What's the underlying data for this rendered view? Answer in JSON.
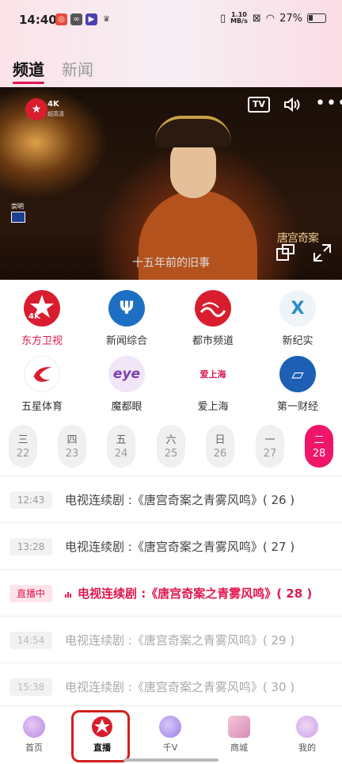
{
  "status_bar": {
    "time": "14:40",
    "speed_value": "1.10",
    "speed_unit": "MB/s",
    "battery": "27%",
    "app_icons": [
      "weibo-icon",
      "app-icon",
      "video-icon",
      "crown-icon"
    ]
  },
  "tabs": [
    {
      "label": "频道",
      "active": true
    },
    {
      "label": "新闻",
      "active": false
    }
  ],
  "video": {
    "channel_badge": "4K",
    "channel_badge_sub": "超高清",
    "corner_text": "崇明",
    "caption": "十五年前的旧事",
    "title_art": "唐宫奇案",
    "tv_label": "TV"
  },
  "channels": [
    {
      "label": "东方卫视",
      "active": true,
      "color": "#d81e2e",
      "icon_text": "4K"
    },
    {
      "label": "新闻综合",
      "active": false,
      "color": "#1d6fc4",
      "icon_text": "Ψ"
    },
    {
      "label": "都市频道",
      "active": false,
      "color": "#d81e2e",
      "icon_text": "~"
    },
    {
      "label": "新纪实",
      "active": false,
      "color": "#2b8cc9",
      "icon_text": "X"
    },
    {
      "label": "五星体育",
      "active": false,
      "color": "#d81e2e",
      "icon_text": "✓"
    },
    {
      "label": "魔都眼",
      "active": false,
      "color": "#7a3fb0",
      "icon_text": "eye"
    },
    {
      "label": "爱上海",
      "active": false,
      "color": "#e0184f",
      "icon_text": "爱上海"
    },
    {
      "label": "第一财经",
      "active": false,
      "color": "#1d5fb5",
      "icon_text": "▱"
    }
  ],
  "days": [
    {
      "weekday": "三",
      "date": "22",
      "active": false
    },
    {
      "weekday": "四",
      "date": "23",
      "active": false
    },
    {
      "weekday": "五",
      "date": "24",
      "active": false
    },
    {
      "weekday": "六",
      "date": "25",
      "active": false
    },
    {
      "weekday": "日",
      "date": "26",
      "active": false
    },
    {
      "weekday": "一",
      "date": "27",
      "active": false
    },
    {
      "weekday": "二",
      "date": "28",
      "active": true
    }
  ],
  "programs": [
    {
      "time": "12:43",
      "title": "电视连续剧 :《唐宫奇案之青雾风鸣》( 26 )",
      "state": "past"
    },
    {
      "time": "13:28",
      "title": "电视连续剧 :《唐宫奇案之青雾风鸣》( 27 )",
      "state": "past"
    },
    {
      "time": "直播中",
      "title": "电视连续剧 :《唐宫奇案之青雾风鸣》( 28 )",
      "state": "live"
    },
    {
      "time": "14:54",
      "title": "电视连续剧 :《唐宫奇案之青雾风鸣》( 29 )",
      "state": "future"
    },
    {
      "time": "15:38",
      "title": "电视连续剧 :《唐宫奇案之青雾风鸣》( 30 )",
      "state": "future"
    }
  ],
  "bottom_nav": [
    {
      "label": "首页",
      "icon": "home-icon",
      "active": false
    },
    {
      "label": "直播",
      "icon": "live-icon",
      "active": true
    },
    {
      "label": "千V",
      "icon": "planet-icon",
      "active": false
    },
    {
      "label": "商城",
      "icon": "cart-icon",
      "active": false
    },
    {
      "label": "我的",
      "icon": "profile-icon",
      "active": false
    }
  ],
  "colors": {
    "accent": "#e0184f",
    "highlight_box": "#d2201f"
  }
}
